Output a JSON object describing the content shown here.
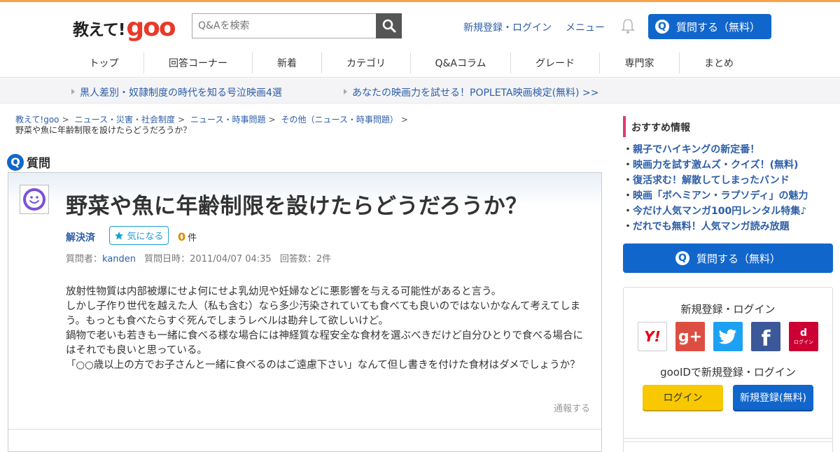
{
  "header": {
    "logo_text": "教えて!",
    "logo_brand": "goo",
    "search_placeholder": "Q&Aを検索",
    "register_login": "新規登録・ログイン",
    "menu": "メニュー",
    "ask_button": "質問する（無料）",
    "q_glyph": "Q"
  },
  "nav": [
    {
      "label": "トップ"
    },
    {
      "label": "回答コーナー"
    },
    {
      "label": "新着"
    },
    {
      "label": "カテゴリ"
    },
    {
      "label": "Q&Aコラム"
    },
    {
      "label": "グレード"
    },
    {
      "label": "専門家"
    },
    {
      "label": "まとめ"
    }
  ],
  "promo": [
    "黒人差別・奴隷制度の時代を知る号泣映画4選",
    "あなたの映画力を試せる！POPLETA映画検定(無料) >>"
  ],
  "breadcrumb": {
    "items": [
      "教えて!goo",
      "ニュース・災害・社会制度",
      "ニュース・時事問題",
      "その他（ニュース・時事問題）"
    ],
    "separator": ">",
    "current": "野菜や魚に年齢制限を設けたらどうだろうか？"
  },
  "question": {
    "section_label": "質問",
    "title": "野菜や魚に年齢制限を設けたらどうだろうか？",
    "status": "解決済",
    "favorite_label": "気になる",
    "favorite_count": "0",
    "count_unit": "件",
    "asker_label": "質問者：",
    "asker": "kanden",
    "date_label": "質問日時：2011/04/07 04:35",
    "answers_label": "回答数：2件",
    "body": "放射性物質は内部被爆にせよ何にせよ乳幼児や妊婦などに悪影響を与える可能性があると言う。\nしかし子作り世代を越えた人（私も含む）なら多少汚染されていても食べても良いのではないかなんて考えてしまう。もっとも食べたらすぐ死んでしまうレベルは勘弁して欲しいけど。\n鍋物で老いも若きも一緒に食べる様な場合には神経質な程安全な食材を選ぶべきだけど自分ひとりで食べる場合にはそれでも良いと思っている。\n「○○歳以上の方でお子さんと一緒に食べるのはご遠慮下さい」なんて但し書きを付けた食材はダメでしょうか？",
    "report": "通報する"
  },
  "sidebar": {
    "recommend_title": "おすすめ情報",
    "recommend_items": [
      "親子でハイキングの新定番！",
      "映画力を試す激ムズ・クイズ！(無料)",
      "復活求む！解散してしまったバンド",
      "映画「ボヘミアン・ラプソディ」の魅力",
      "今だけ人気マンガ100円レンタル特集♪",
      "だれでも無料！人気マンガ読み放題"
    ],
    "ask_button": "質問する（無料）",
    "login_title": "新規登録・ログイン",
    "social": [
      {
        "name": "yahoo",
        "label": "Y!",
        "color": "#ffffff"
      },
      {
        "name": "google-plus",
        "label": "g+",
        "color": "#dc4e41"
      },
      {
        "name": "twitter",
        "label": "",
        "color": "#1da1f2"
      },
      {
        "name": "facebook",
        "label": "f",
        "color": "#3b5998"
      },
      {
        "name": "docomo",
        "label": "d",
        "sublabel": "ログイン",
        "color": "#cc0033"
      }
    ],
    "gooid_text": "gooIDで新規登録・ログイン",
    "login_button": "ログイン",
    "register_button": "新規登録(無料)"
  },
  "colors": {
    "accent_blue": "#1166cc",
    "link": "#2c5ea8",
    "top_bar": "#f7a24b",
    "recommend_accent": "#e5386c",
    "login_yellow": "#f8c800"
  }
}
